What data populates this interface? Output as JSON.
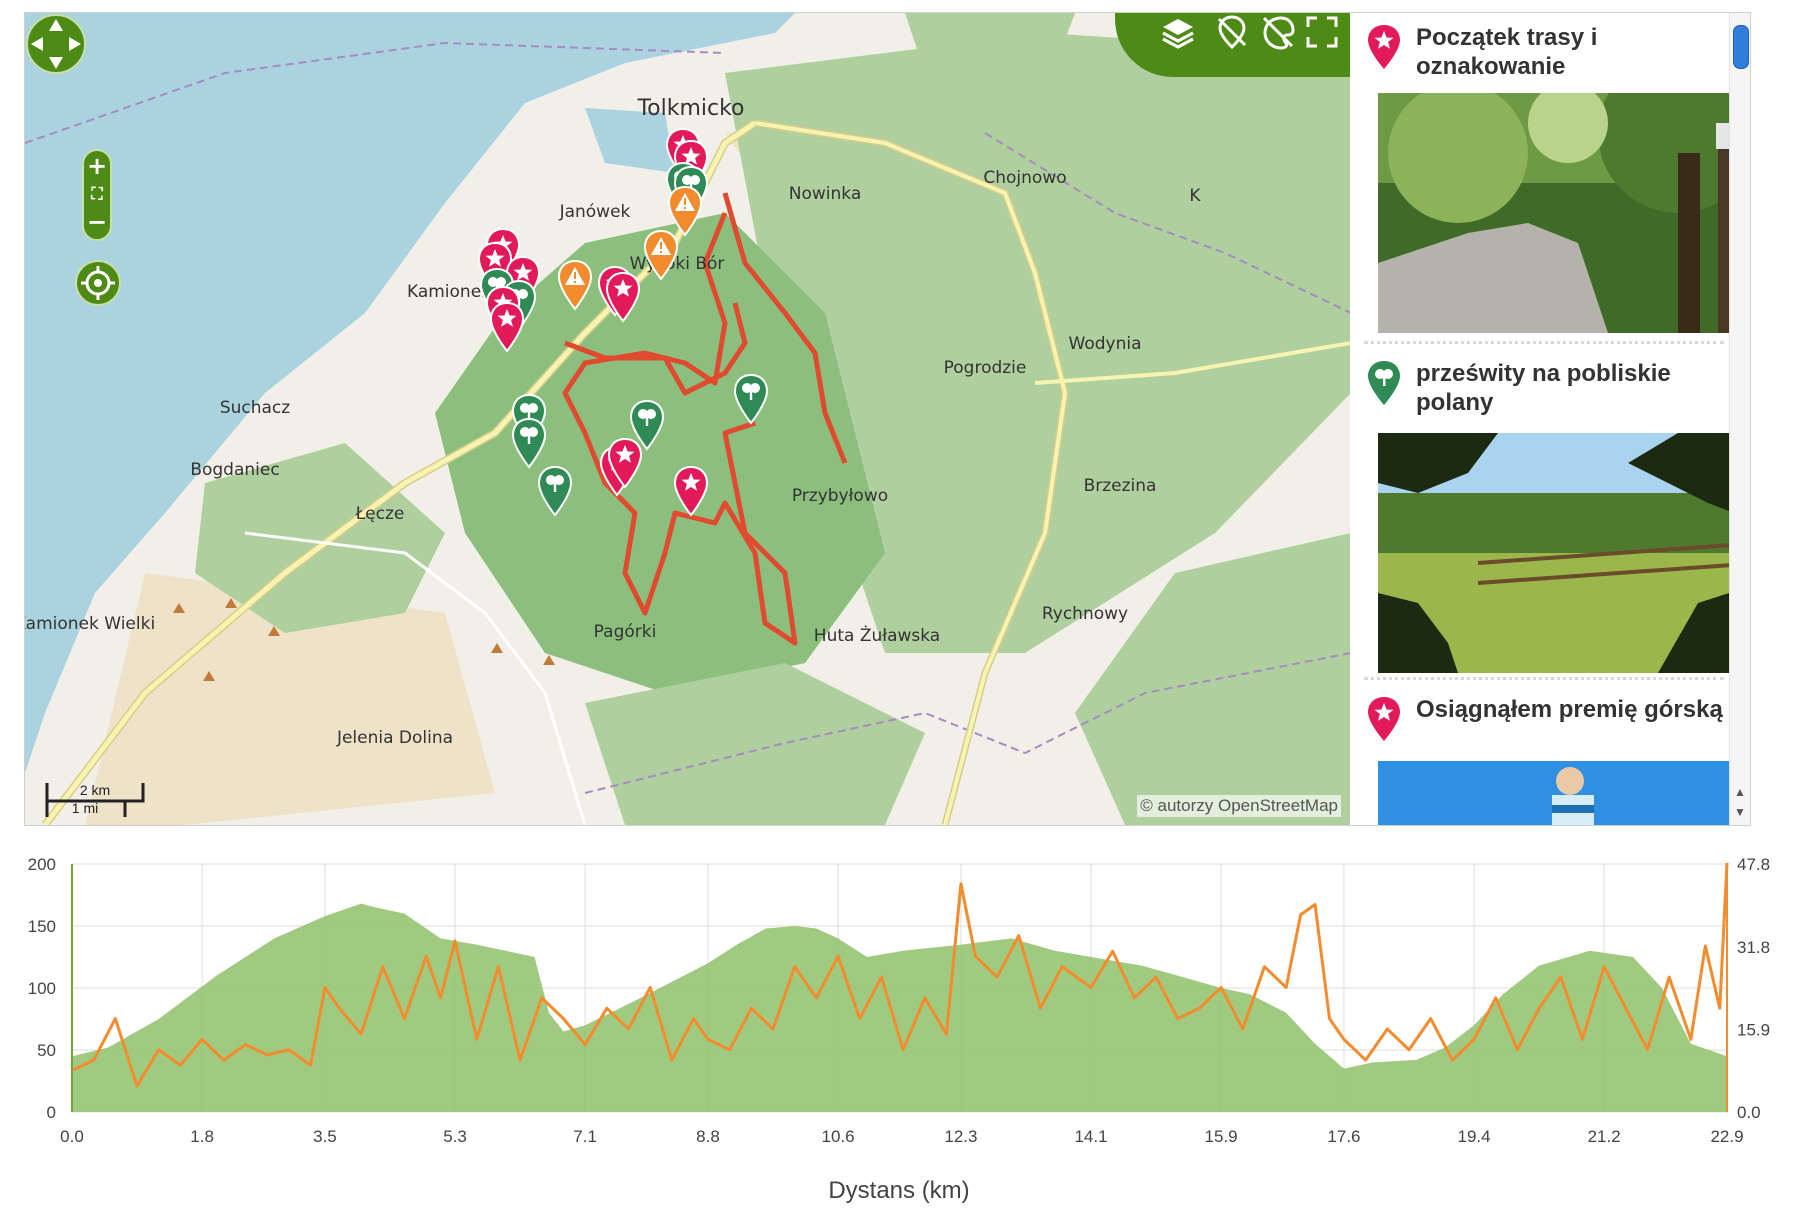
{
  "map": {
    "colors": {
      "water": "#aad3df",
      "land": "#f2efe9",
      "forest": "#afd09e",
      "forest_dark": "#8cbf7e",
      "route": "#e04a2e",
      "road": "#f6f4b0",
      "road_edge": "#d8cc8a",
      "boundary": "#a58bc0"
    },
    "places": [
      {
        "name": "Tolkmicko"
      },
      {
        "name": "Chojnowo"
      },
      {
        "name": "Nowinka"
      },
      {
        "name": "Janówek"
      },
      {
        "name": "Wysoki Bór"
      },
      {
        "name": "Kamionek"
      },
      {
        "name": "Suchacz"
      },
      {
        "name": "Bogdaniec"
      },
      {
        "name": "Łęcze"
      },
      {
        "name": "Pogrodzie"
      },
      {
        "name": "Wodynia"
      },
      {
        "name": "Przybyłowo"
      },
      {
        "name": "Brzezina"
      },
      {
        "name": "Rychnowy"
      },
      {
        "name": "Huta Żuławska"
      },
      {
        "name": "Pagórki"
      },
      {
        "name": "Kamionek Wielki"
      },
      {
        "name": "Jelenia Dolina"
      },
      {
        "name": "K"
      }
    ],
    "markers": [
      {
        "type": "attraction",
        "color": "#e2195a"
      },
      {
        "type": "attraction",
        "color": "#e2195a"
      },
      {
        "type": "view",
        "color": "#2f8a55"
      },
      {
        "type": "view",
        "color": "#2f8a55"
      },
      {
        "type": "warning",
        "color": "#f28a2e"
      },
      {
        "type": "warning",
        "color": "#f28a2e"
      },
      {
        "type": "attraction",
        "color": "#e2195a"
      },
      {
        "type": "attraction",
        "color": "#e2195a"
      },
      {
        "type": "attraction",
        "color": "#e2195a"
      },
      {
        "type": "view",
        "color": "#2f8a55"
      },
      {
        "type": "view",
        "color": "#2f8a55"
      },
      {
        "type": "attraction",
        "color": "#e2195a"
      },
      {
        "type": "warning",
        "color": "#f28a2e"
      },
      {
        "type": "attraction",
        "color": "#e2195a"
      },
      {
        "type": "attraction",
        "color": "#e2195a"
      },
      {
        "type": "attraction",
        "color": "#e2195a"
      },
      {
        "type": "view",
        "color": "#2f8a55"
      },
      {
        "type": "view",
        "color": "#2f8a55"
      },
      {
        "type": "view",
        "color": "#2f8a55"
      },
      {
        "type": "view",
        "color": "#2f8a55"
      },
      {
        "type": "view",
        "color": "#2f8a55"
      },
      {
        "type": "attraction",
        "color": "#e2195a"
      },
      {
        "type": "attraction",
        "color": "#e2195a"
      },
      {
        "type": "attraction",
        "color": "#e2195a"
      }
    ],
    "scale": {
      "km": "2 km",
      "mi": "1 mi"
    },
    "attribution": "© autorzy OpenStreetMap",
    "controls": {
      "zoom_in": "+",
      "zoom_out": "−",
      "icons": [
        "layers-icon",
        "hide-markers-icon",
        "hide-photos-icon",
        "fullscreen-icon"
      ]
    }
  },
  "panel": {
    "items": [
      {
        "title": "Początek trasy i oznakowanie",
        "icon": "star-pin-icon",
        "color": "#e2195a",
        "photo": "forest-path-photo"
      },
      {
        "title": "prześwity na pobliskie polany",
        "icon": "tree-pin-icon",
        "color": "#2f8a55",
        "photo": "meadow-photo"
      },
      {
        "title": "Osiągnąłem premię górską",
        "icon": "star-pin-icon",
        "color": "#e2195a",
        "photo": "cyclist-photo"
      }
    ]
  },
  "chart_data": {
    "type": "area",
    "xlabel": "Dystans (km)",
    "x_ticks": [
      "0.0",
      "1.8",
      "3.5",
      "5.3",
      "7.1",
      "8.8",
      "10.6",
      "12.3",
      "14.1",
      "15.9",
      "17.6",
      "19.4",
      "21.2",
      "22.9"
    ],
    "y_left_ticks": [
      "0",
      "50",
      "100",
      "150",
      "200"
    ],
    "y_right_ticks": [
      "0.0",
      "15.9",
      "31.8",
      "47.8"
    ],
    "xlim": [
      0,
      22.9
    ],
    "ylim_left": [
      0,
      200
    ],
    "ylim_right": [
      0,
      47.8
    ],
    "grid": true,
    "series": [
      {
        "axis": "left",
        "style": "area",
        "color": "#8fc16a",
        "x": [
          0,
          0.5,
          1.2,
          2,
          2.8,
          3.5,
          4,
          4.2,
          4.6,
          5.1,
          5.6,
          6,
          6.4,
          6.6,
          6.8,
          7.1,
          7.8,
          8.8,
          9.2,
          9.6,
          10,
          10.3,
          10.6,
          11,
          11.5,
          12.3,
          13,
          13.6,
          14.1,
          14.8,
          15.3,
          15.9,
          16.3,
          16.8,
          17.2,
          17.6,
          18,
          18.6,
          19,
          19.4,
          19.8,
          20.3,
          21,
          21.6,
          22,
          22.4,
          22.9
        ],
        "y": [
          45,
          52,
          75,
          110,
          140,
          158,
          168,
          165,
          160,
          140,
          135,
          130,
          125,
          80,
          65,
          70,
          90,
          120,
          135,
          148,
          150,
          148,
          140,
          125,
          130,
          135,
          140,
          130,
          125,
          118,
          110,
          100,
          95,
          80,
          55,
          35,
          40,
          42,
          52,
          70,
          95,
          118,
          130,
          125,
          100,
          55,
          45
        ]
      },
      {
        "axis": "right",
        "style": "line",
        "color": "#f28c2e",
        "x": [
          0,
          0.3,
          0.6,
          0.9,
          1.2,
          1.5,
          1.8,
          2.1,
          2.4,
          2.7,
          3,
          3.3,
          3.5,
          3.7,
          4,
          4.3,
          4.6,
          4.9,
          5.1,
          5.3,
          5.6,
          5.9,
          6.2,
          6.5,
          6.8,
          7.1,
          7.4,
          7.7,
          8,
          8.3,
          8.6,
          8.8,
          9.1,
          9.4,
          9.7,
          10,
          10.3,
          10.6,
          10.9,
          11.2,
          11.5,
          11.8,
          12.1,
          12.3,
          12.5,
          12.8,
          13.1,
          13.4,
          13.7,
          14.1,
          14.4,
          14.7,
          15,
          15.3,
          15.6,
          15.9,
          16.2,
          16.5,
          16.8,
          17,
          17.2,
          17.4,
          17.6,
          17.9,
          18.2,
          18.5,
          18.8,
          19.1,
          19.4,
          19.7,
          20,
          20.3,
          20.6,
          20.9,
          21.2,
          21.5,
          21.8,
          22.1,
          22.4,
          22.6,
          22.8,
          22.9
        ],
        "y": [
          8,
          10,
          18,
          5,
          12,
          9,
          14,
          10,
          13,
          11,
          12,
          9,
          24,
          20,
          15,
          28,
          18,
          30,
          22,
          33,
          14,
          28,
          10,
          22,
          18,
          13,
          20,
          16,
          24,
          10,
          18,
          14,
          12,
          20,
          16,
          28,
          22,
          30,
          18,
          26,
          12,
          22,
          15,
          44,
          30,
          26,
          34,
          20,
          28,
          24,
          31,
          22,
          26,
          18,
          20,
          24,
          16,
          28,
          24,
          38,
          40,
          18,
          14,
          10,
          16,
          12,
          18,
          10,
          14,
          22,
          12,
          20,
          26,
          14,
          28,
          20,
          12,
          26,
          14,
          32,
          20,
          48
        ]
      }
    ]
  }
}
